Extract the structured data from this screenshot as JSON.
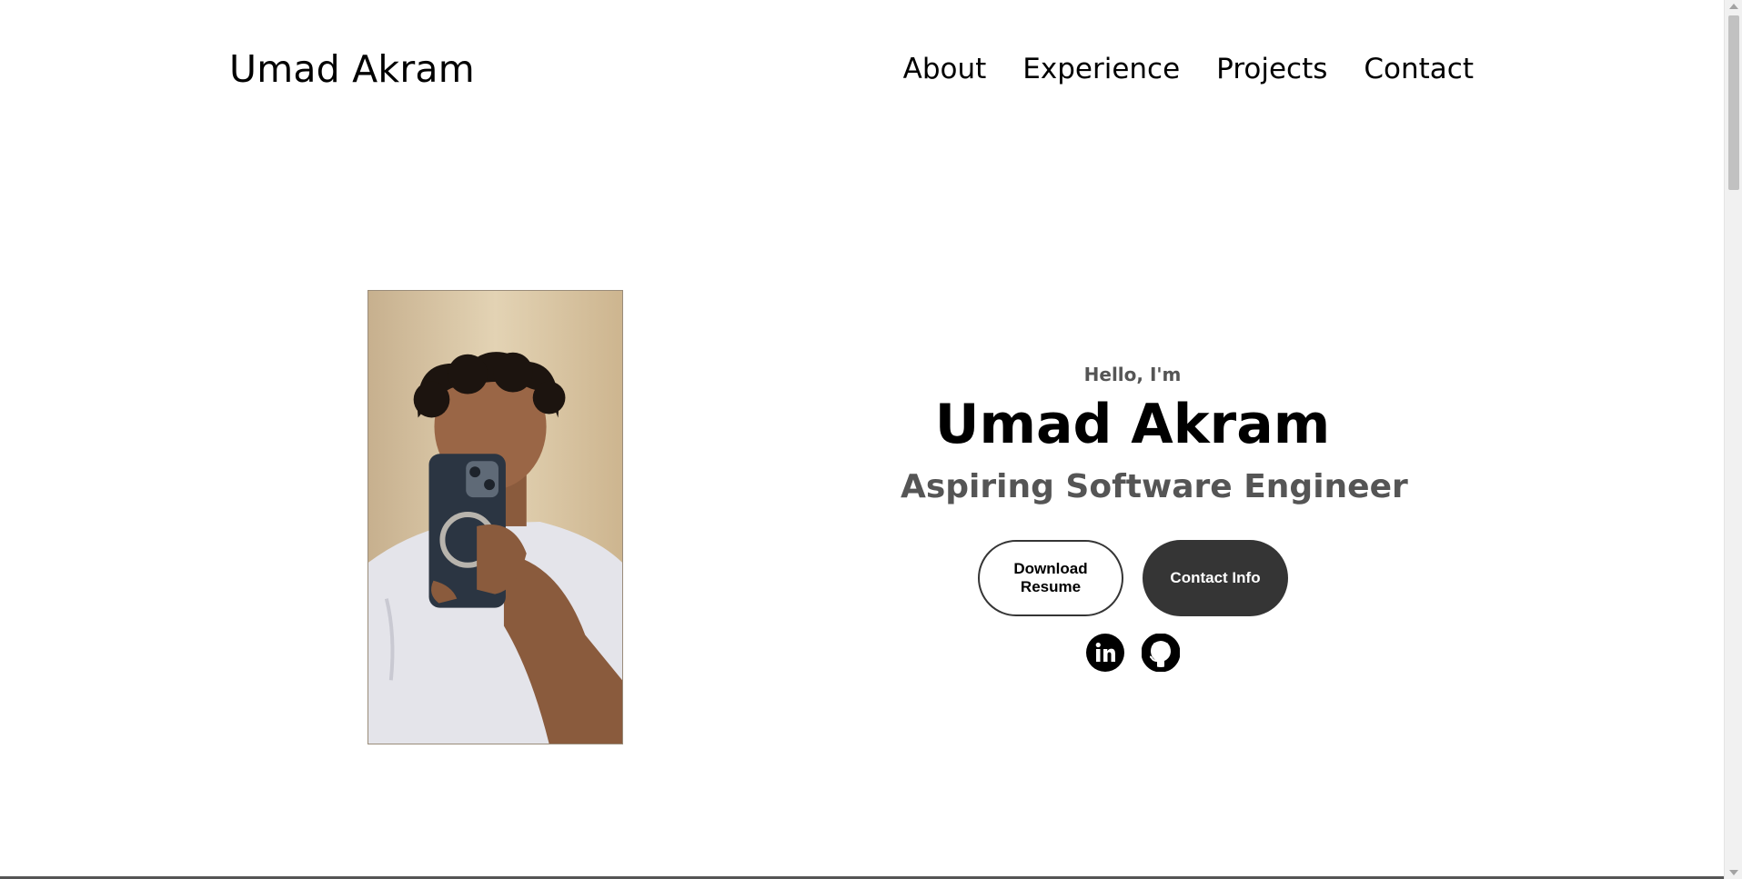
{
  "header": {
    "logo_text": "Umad Akram",
    "nav_items": [
      {
        "label": "About"
      },
      {
        "label": "Experience"
      },
      {
        "label": "Projects"
      },
      {
        "label": "Contact"
      }
    ]
  },
  "hero": {
    "greeting": "Hello, I'm",
    "name": "Umad Akram",
    "title": "Aspiring Software Engineer",
    "buttons": {
      "download_resume": "Download Resume",
      "contact_info": "Contact Info"
    },
    "socials": [
      {
        "icon": "linkedin-icon"
      },
      {
        "icon": "github-icon"
      }
    ],
    "photo_alt": "profile-photo"
  },
  "colors": {
    "background": "#ffffff",
    "text": "#000000",
    "muted_text": "#555555",
    "button_dark": "#353535"
  }
}
